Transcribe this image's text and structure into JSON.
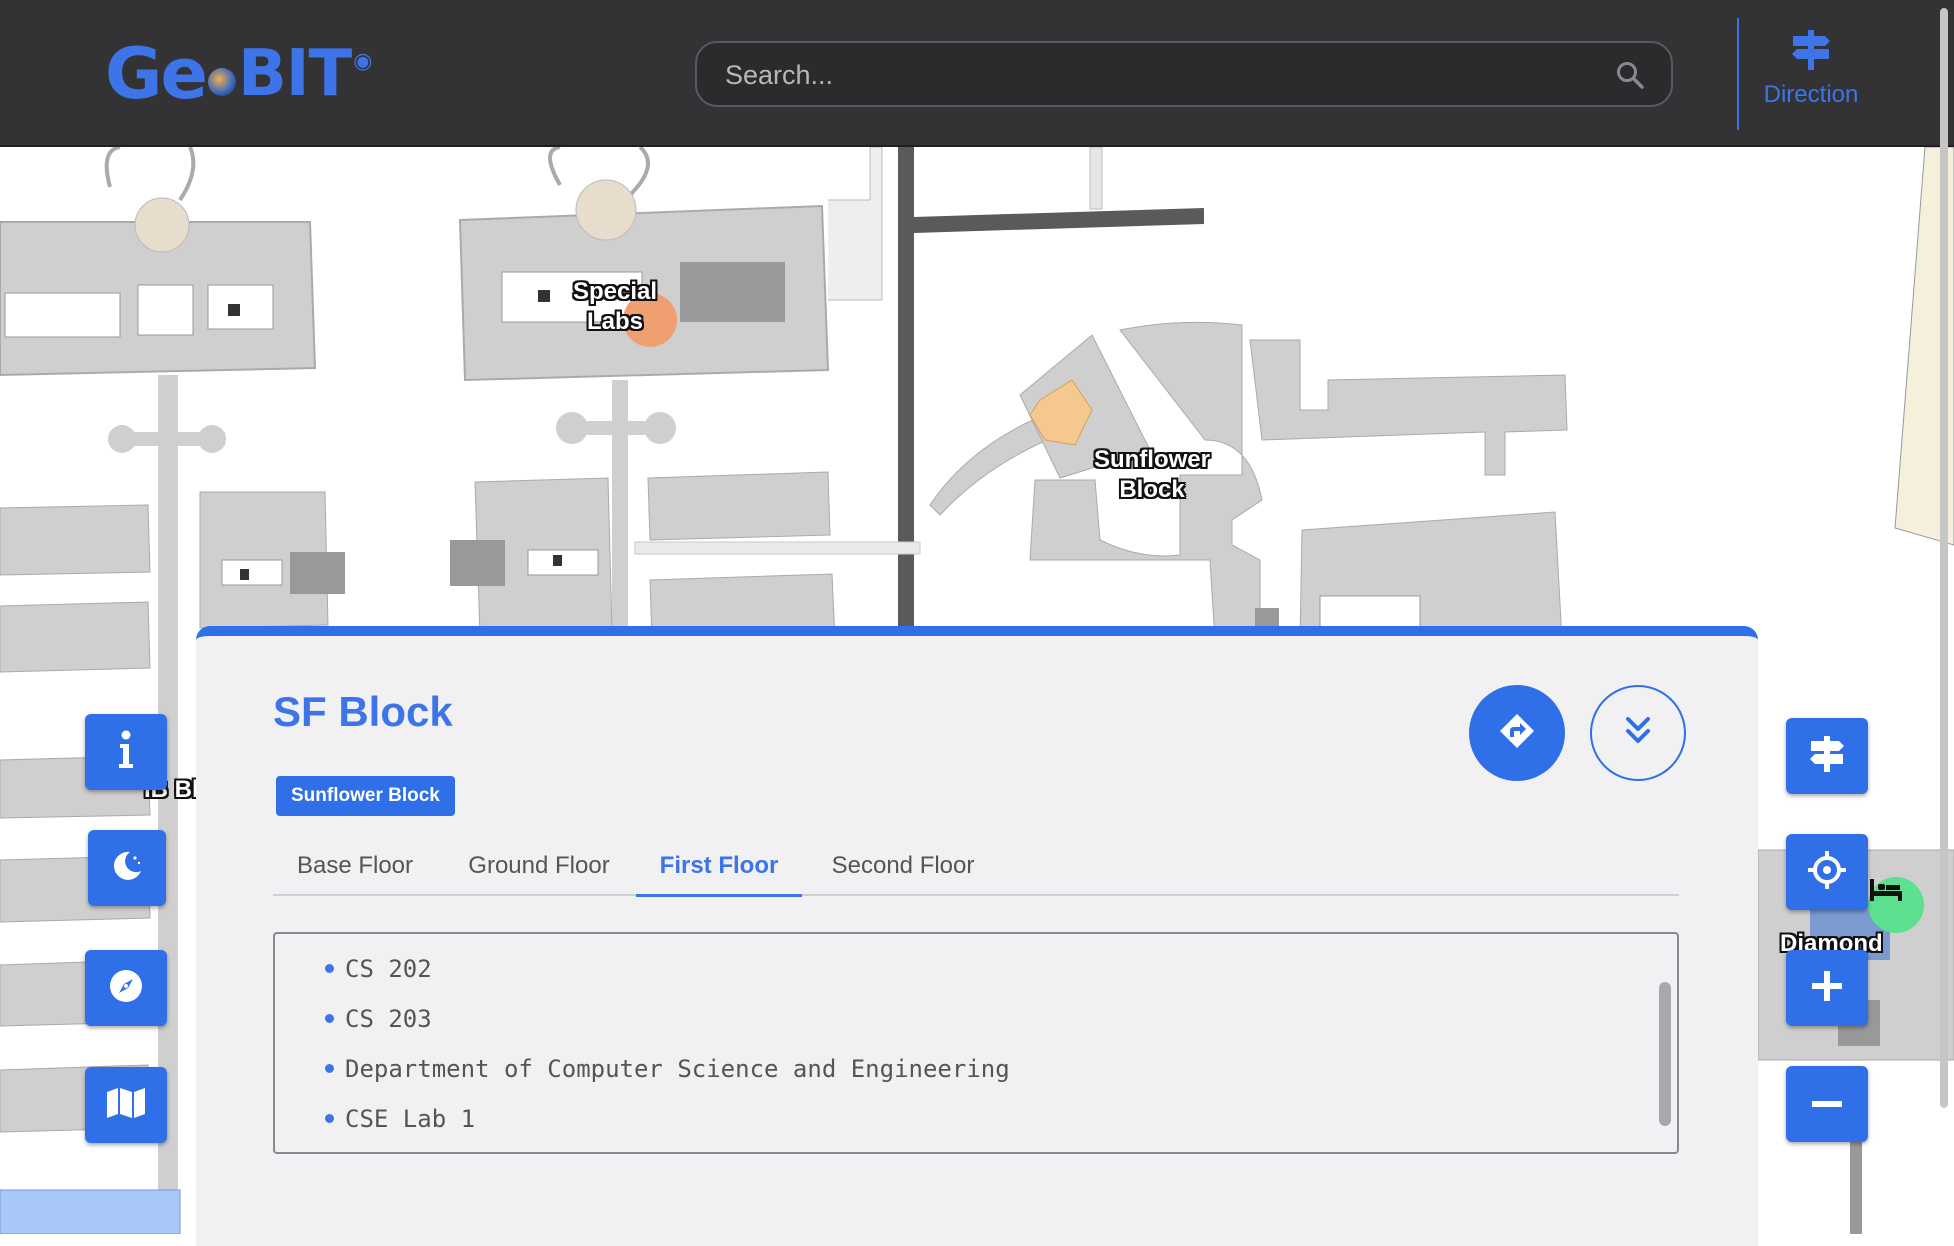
{
  "header": {
    "logo": {
      "geo": "Ge",
      "bit": "BIT",
      "alt": "GeoBITs"
    },
    "search": {
      "placeholder": "Search..."
    },
    "direction_label": "Direction"
  },
  "map": {
    "labels": {
      "special_labs": "Special\nLabs",
      "sunflower_block": "Sunflower\nBlock",
      "ib_block_partial": "IB Bl",
      "diamond": "Diamond"
    }
  },
  "side_controls": {
    "left": [
      "info-icon",
      "moon-icon",
      "compass-icon",
      "map-icon"
    ],
    "right": [
      "signpost-icon",
      "crosshair-icon",
      "plus-icon",
      "minus-icon"
    ]
  },
  "panel": {
    "title": "SF Block",
    "badge": "Sunflower Block",
    "tabs": [
      {
        "label": "Base Floor",
        "active": false
      },
      {
        "label": "Ground Floor",
        "active": false
      },
      {
        "label": "First Floor",
        "active": true
      },
      {
        "label": "Second Floor",
        "active": false
      }
    ],
    "rooms": [
      "CS 202",
      "CS 203",
      "Department of Computer Science and Engineering",
      "CSE Lab 1"
    ]
  },
  "colors": {
    "accent": "#2f6fe8",
    "header_bg": "#333335",
    "panel_bg": "#f1f1f3",
    "building": "#cfcfcf",
    "hostel_marker": "#5de08f",
    "lab_marker": "#f0a070"
  }
}
